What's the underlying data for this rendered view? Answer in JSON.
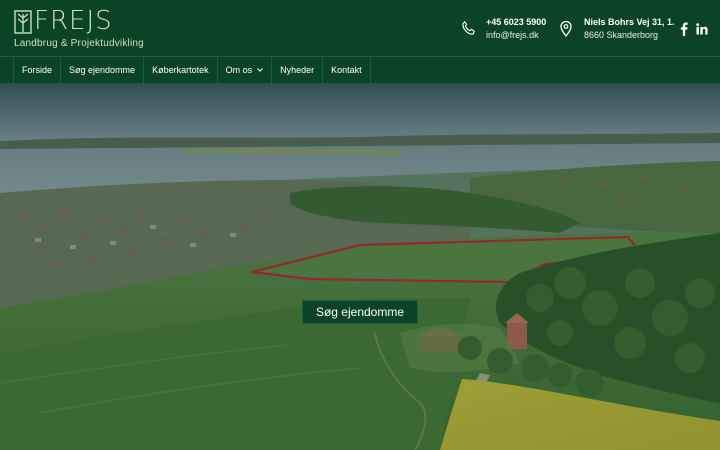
{
  "brand": {
    "name": "FREJS",
    "tagline": "Landbrug & Projektudvikling",
    "logo_icon": "frejs-logo-mark"
  },
  "contact": {
    "phone": "+45 6023 5900",
    "email": "info@frejs.dk",
    "address_line1": "Niels Bohrs Vej 31, 1.",
    "address_line2": "8660 Skanderborg",
    "phone_icon": "phone-icon",
    "location_icon": "location-pin-icon"
  },
  "social": [
    "facebook-icon",
    "linkedin-icon"
  ],
  "nav": {
    "items": [
      {
        "label": "Forside"
      },
      {
        "label": "Søg ejendomme"
      },
      {
        "label": "Køberkartotek"
      },
      {
        "label": "Om os",
        "has_dropdown": true
      },
      {
        "label": "Nyheder"
      },
      {
        "label": "Kontakt"
      }
    ]
  },
  "hero": {
    "cta_label": "Søg ejendomme"
  },
  "colors": {
    "brand_green": "#0a4424",
    "logo_tint": "#cfe0c6",
    "property_outline": "#c0283a"
  }
}
